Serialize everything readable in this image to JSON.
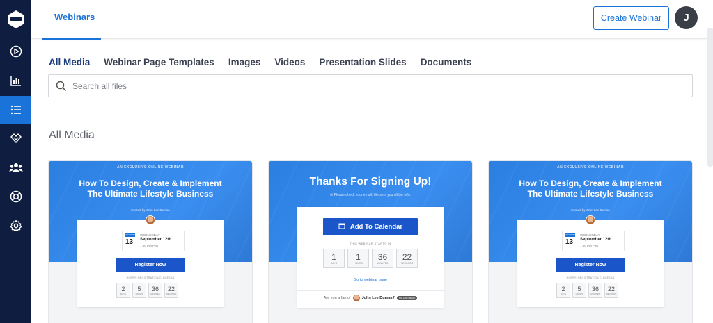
{
  "sidebar": {
    "logo": "logo-icon",
    "items": [
      {
        "name": "play-icon",
        "active": false
      },
      {
        "name": "analytics-icon",
        "active": false
      },
      {
        "name": "list-icon",
        "active": true
      },
      {
        "name": "integrations-icon",
        "active": false
      },
      {
        "name": "team-icon",
        "active": false
      },
      {
        "name": "support-icon",
        "active": false
      },
      {
        "name": "settings-icon",
        "active": false
      }
    ],
    "active_color": "#1a73d9",
    "bg_color": "#0f1d40"
  },
  "header": {
    "tab_label": "Webinars",
    "create_button": "Create Webinar",
    "avatar_initial": "J"
  },
  "media_tabs": [
    "All Media",
    "Webinar Page Templates",
    "Images",
    "Videos",
    "Presentation Slides",
    "Documents"
  ],
  "active_media_tab": "All Media",
  "search": {
    "placeholder": "Search all files"
  },
  "section_title": "All Media",
  "cards": [
    {
      "eyebrow": "AN EXCLUSIVE ONLINE WEBINAR",
      "title_line1": "How To  Design, Create & Implement",
      "title_line2": "The Ultimate Lifestyle Business",
      "hosted": "Hosted by John Lee Dumas",
      "date_tag": "UPCOMING",
      "date_num": "13",
      "date_day": "WEDNESDAY",
      "date_full": "September 12th",
      "date_time": "7:00 PM PST",
      "register": "Register Now",
      "closes": "HURRY! REGISTRATION CLOSES IN",
      "countdown": [
        {
          "num": "2",
          "unit": "DAYS"
        },
        {
          "num": "5",
          "unit": "HOURS"
        },
        {
          "num": "36",
          "unit": "MINUTES"
        },
        {
          "num": "22",
          "unit": "SECONDS"
        }
      ]
    },
    {
      "title": "Thanks For Signing Up!",
      "note": "Please check your email. We sent you all the info.",
      "calendar_button": "Add To Calendar",
      "starts": "THIS WEBINAR STARTS IN",
      "countdown": [
        {
          "num": "1",
          "unit": "DAYS"
        },
        {
          "num": "1",
          "unit": "HOURS"
        },
        {
          "num": "36",
          "unit": "MINUTES"
        },
        {
          "num": "22",
          "unit": "SECONDS"
        }
      ],
      "goto": "Go to webinar page",
      "fan_text": "Are you a fan of",
      "fan_name": "John Lee Dumas?",
      "fan_follow": "FOLLOW ME ON"
    },
    {
      "eyebrow": "AN EXCLUSIVE ONLINE WEBINAR",
      "title_line1": "How To  Design, Create & Implement",
      "title_line2": "The Ultimate Lifestyle Business",
      "hosted": "Hosted by John Lee Dumas",
      "date_tag": "UPCOMING",
      "date_num": "13",
      "date_day": "WEDNESDAY",
      "date_full": "September 12th",
      "date_time": "7:00 PM PST",
      "register": "Register Now",
      "closes": "HURRY! REGISTRATION CLOSES IN",
      "countdown": [
        {
          "num": "2",
          "unit": "DAYS"
        },
        {
          "num": "5",
          "unit": "HOURS"
        },
        {
          "num": "36",
          "unit": "MINUTES"
        },
        {
          "num": "22",
          "unit": "SECONDS"
        }
      ]
    }
  ]
}
